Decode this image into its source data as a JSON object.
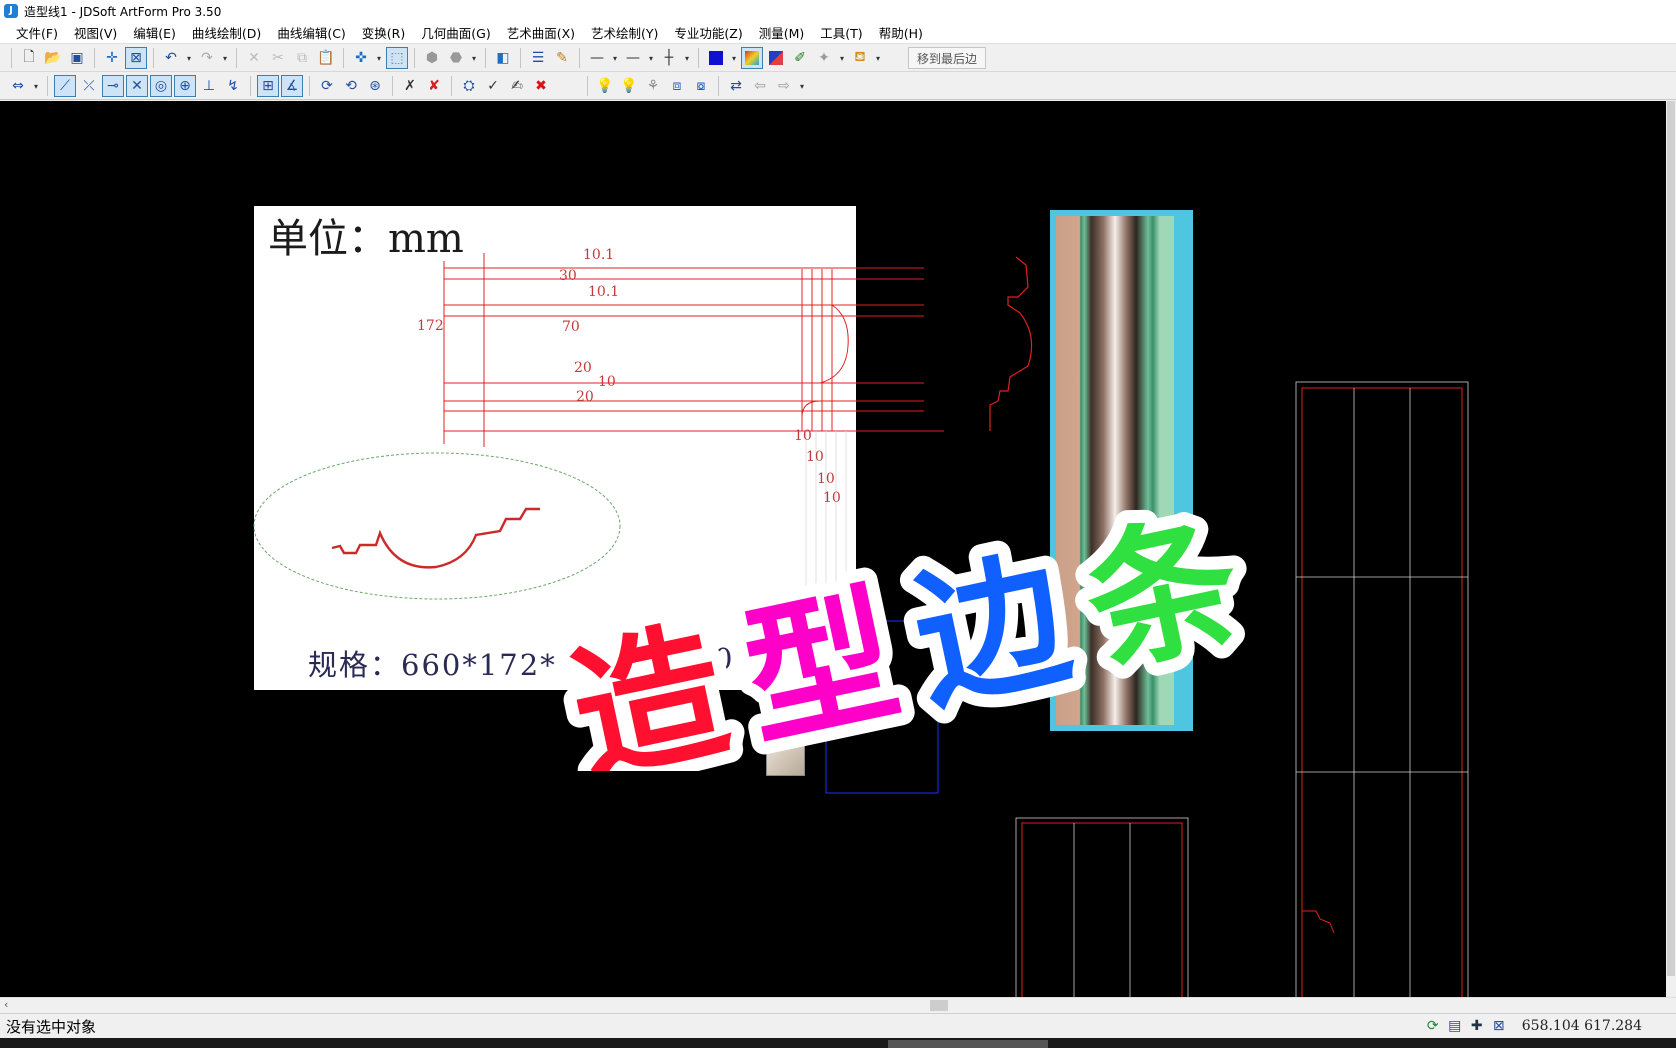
{
  "window": {
    "title": "造型线1 - JDSoft ArtForm Pro 3.50"
  },
  "menu": [
    "文件(F)",
    "视图(V)",
    "编辑(E)",
    "曲线绘制(D)",
    "曲线编辑(C)",
    "变换(R)",
    "几何曲面(G)",
    "艺术曲面(X)",
    "艺术绘制(Y)",
    "专业功能(Z)",
    "测量(M)",
    "工具(T)",
    "帮助(H)"
  ],
  "toolbar": {
    "move_to_end_label": "移到最后边"
  },
  "drawing": {
    "unit_label": "单位：mm",
    "spec_label": "规格：660*172*",
    "spec_tail": "0",
    "dims": {
      "d10_1_top": "10.1",
      "d30": "30",
      "d10_1_mid": "10.1",
      "d172": "172",
      "d70": "70",
      "d20_a": "20",
      "d10_mid": "10",
      "d20_b": "20",
      "d10_v1": "10",
      "d10_v2": "10",
      "d10_v3": "10",
      "d10_v4": "10"
    }
  },
  "watermark": {
    "text": "造型边条",
    "chars": [
      "造",
      "型",
      "边",
      "条"
    ]
  },
  "status": {
    "message": "没有选中对象",
    "coords": "658.104 617.284"
  },
  "colors": {
    "canvas": "#000000",
    "line_red": "#e02020",
    "line_blue": "#2030ff",
    "ellipse_green": "#6aa86a",
    "watermark_red": "#ff1030",
    "watermark_magenta": "#ff00c8",
    "watermark_blue": "#1060ff",
    "watermark_green": "#30e040"
  },
  "icons": {
    "toolbar1": [
      "new-file-icon",
      "open-file-icon",
      "save-icon",
      "snap-cross-icon",
      "snap-box-icon",
      "undo-icon",
      "redo-icon",
      "cut-disabled-icon",
      "scissors-icon",
      "copy-icon",
      "paste-icon",
      "crosshair-icon",
      "view-cube-icon",
      "shade-icon",
      "render-icon",
      "layer-icon",
      "list-icon",
      "pen-icon",
      "line-style-icon",
      "line-weight-icon",
      "crosshair2-icon",
      "color-blue-icon",
      "gradient-icon",
      "color-swap-icon",
      "eyedropper-icon",
      "spray-icon",
      "paint-bucket-icon"
    ],
    "toolbar2": [
      "arrow-left-right-icon",
      "snap-line-icon",
      "snap-tangent-icon",
      "snap-mid-icon",
      "snap-intersect-icon",
      "snap-center-icon",
      "snap-circle-icon",
      "snap-perp-icon",
      "snap-near-icon",
      "grid-icon",
      "angle-icon",
      "view-rotate-icon",
      "view-pan-icon",
      "view-zoom-icon",
      "trim-icon",
      "delete-curve-icon",
      "node-icon",
      "tick-icon",
      "edit-icon",
      "close-red-icon",
      "light-blue-icon",
      "light-green-icon",
      "light-multi-icon",
      "light-frame-icon",
      "light-select-icon",
      "refresh-icon",
      "back-icon",
      "forward-icon"
    ]
  }
}
